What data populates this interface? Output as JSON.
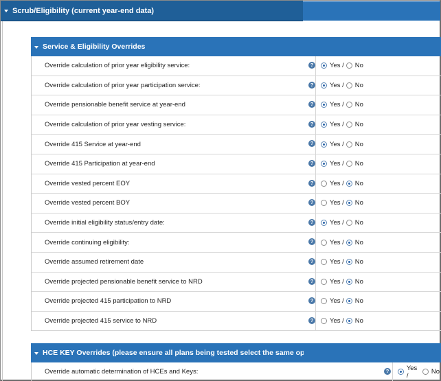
{
  "main_panel": {
    "title": "Scrub/Eligibility (current year-end data)"
  },
  "sections": [
    {
      "title": "Service & Eligibility Overrides",
      "rows": [
        {
          "label": "Override calculation of prior year eligibility service:",
          "yes": "Yes /",
          "no": "No",
          "selected": "yes"
        },
        {
          "label": "Override calculation of prior year participation service:",
          "yes": "Yes /",
          "no": "No",
          "selected": "yes"
        },
        {
          "label": "Override pensionable benefit service at year-end",
          "yes": "Yes /",
          "no": "No",
          "selected": "yes"
        },
        {
          "label": "Override calculation of prior year vesting service:",
          "yes": "Yes /",
          "no": "No",
          "selected": "yes"
        },
        {
          "label": "Override 415 Service at year-end",
          "yes": "Yes /",
          "no": "No",
          "selected": "yes"
        },
        {
          "label": "Override 415 Participation at year-end",
          "yes": "Yes /",
          "no": "No",
          "selected": "yes"
        },
        {
          "label": "Override vested percent EOY",
          "yes": "Yes /",
          "no": "No",
          "selected": "no"
        },
        {
          "label": "Override vested percent BOY",
          "yes": "Yes /",
          "no": "No",
          "selected": "no"
        },
        {
          "label": "Override initial eligibility status/entry date:",
          "yes": "Yes /",
          "no": "No",
          "selected": "yes"
        },
        {
          "label": "Override continuing eligibility:",
          "yes": "Yes /",
          "no": "No",
          "selected": "no"
        },
        {
          "label": "Override assumed retirement date",
          "yes": "Yes /",
          "no": "No",
          "selected": "no"
        },
        {
          "label": "Override projected pensionable benefit service to NRD",
          "yes": "Yes /",
          "no": "No",
          "selected": "no"
        },
        {
          "label": "Override projected 415 participation to NRD",
          "yes": "Yes /",
          "no": "No",
          "selected": "no"
        },
        {
          "label": "Override projected 415 service to NRD",
          "yes": "Yes /",
          "no": "No",
          "selected": "no"
        }
      ]
    },
    {
      "title": "HCE KEY Overrides (please ensure all plans being tested select the same options)",
      "rows": [
        {
          "label": "Override automatic determination of HCEs and Keys:",
          "yes": "Yes /",
          "no": "No",
          "selected": "yes"
        }
      ]
    }
  ],
  "help_glyph": "?",
  "icons": {
    "collapse": "caret-down-icon",
    "help": "help-icon"
  }
}
